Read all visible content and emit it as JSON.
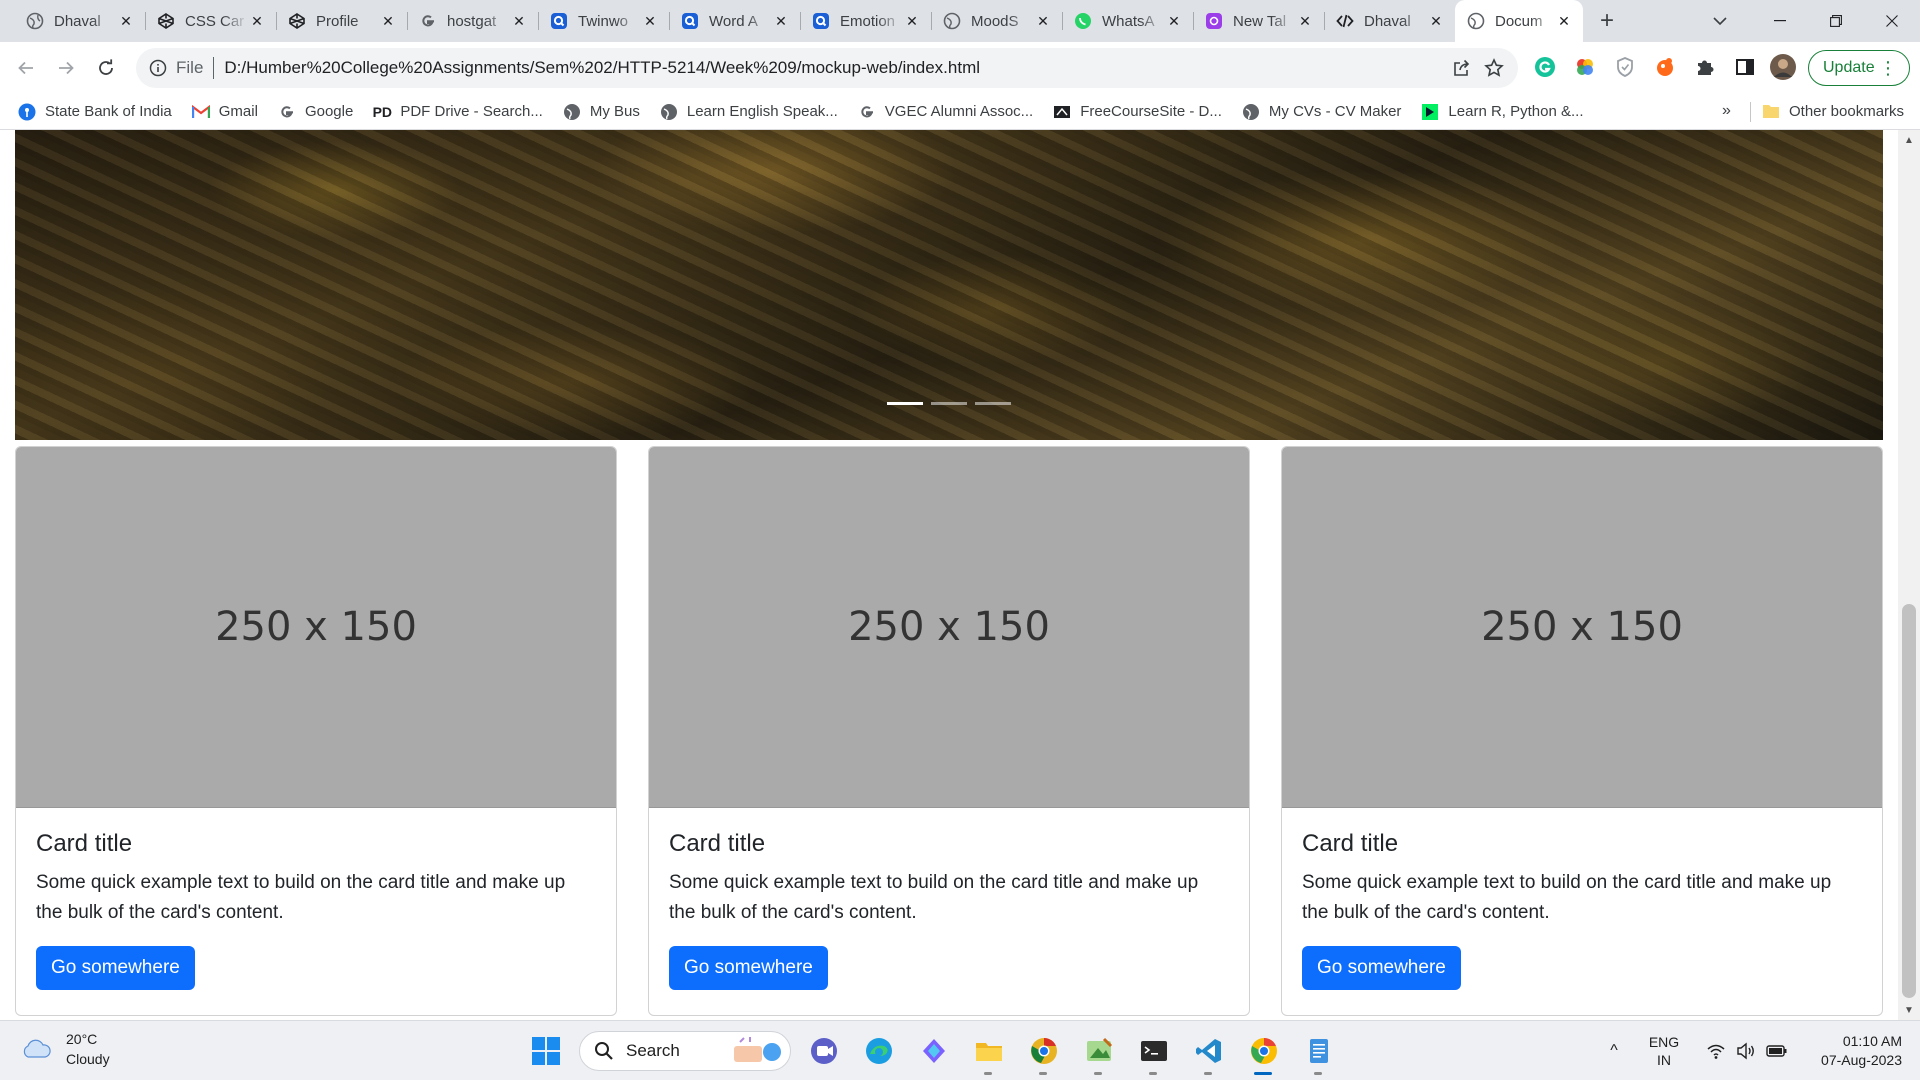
{
  "browser": {
    "tabs": [
      {
        "title": "Dhaval",
        "icon": "globe-icon"
      },
      {
        "title": "CSS Car",
        "icon": "codepen-icon"
      },
      {
        "title": "Profile",
        "icon": "codepen-icon"
      },
      {
        "title": "hostgat",
        "icon": "google-icon"
      },
      {
        "title": "Twinwo",
        "icon": "quillbot-icon"
      },
      {
        "title": "Word A",
        "icon": "quillbot-icon"
      },
      {
        "title": "Emotion",
        "icon": "quillbot-icon"
      },
      {
        "title": "MoodS",
        "icon": "globe-icon"
      },
      {
        "title": "WhatsA",
        "icon": "whatsapp-icon"
      },
      {
        "title": "New Tal",
        "icon": "newtab-icon"
      },
      {
        "title": "Dhaval",
        "icon": "code-icon"
      },
      {
        "title": "Docum",
        "icon": "globe-icon",
        "active": true
      }
    ],
    "address": {
      "scheme": "File",
      "url": "D:/Humber%20College%20Assignments/Sem%202/HTTP-5214/Week%209/mockup-web/index.html"
    },
    "update_label": "Update",
    "bookmarks": [
      {
        "label": "State Bank of India",
        "icon": "sbi-icon"
      },
      {
        "label": "Gmail",
        "icon": "gmail-icon"
      },
      {
        "label": "Google",
        "icon": "google-icon"
      },
      {
        "label": "PDF Drive - Search...",
        "icon": "pdfdrive-icon"
      },
      {
        "label": "My Bus",
        "icon": "globe-icon"
      },
      {
        "label": "Learn English Speak...",
        "icon": "globe-icon"
      },
      {
        "label": "VGEC Alumni Assoc...",
        "icon": "google-icon"
      },
      {
        "label": "FreeCourseSite - D...",
        "icon": "freecourse-icon"
      },
      {
        "label": "My CVs - CV Maker",
        "icon": "globe-icon"
      },
      {
        "label": "Learn R, Python &...",
        "icon": "datacamp-icon"
      }
    ],
    "bookmarks_overflow": "»",
    "other_bookmarks": "Other bookmarks"
  },
  "page": {
    "carousel": {
      "indicators": 3,
      "active_index": 0
    },
    "cards": [
      {
        "image_placeholder": "250 x 150",
        "title": "Card title",
        "text": "Some quick example text to build on the card title and make up the bulk of the card's content.",
        "button": "Go somewhere"
      },
      {
        "image_placeholder": "250 x 150",
        "title": "Card title",
        "text": "Some quick example text to build on the card title and make up the bulk of the card's content.",
        "button": "Go somewhere"
      },
      {
        "image_placeholder": "250 x 150",
        "title": "Card title",
        "text": "Some quick example text to build on the card title and make up the bulk of the card's content.",
        "button": "Go somewhere"
      }
    ]
  },
  "taskbar": {
    "weather": {
      "temp": "20°C",
      "condition": "Cloudy"
    },
    "search_label": "Search",
    "apps": [
      "widgets-icon",
      "teams-icon",
      "edge-icon",
      "copilot-icon",
      "file-explorer-icon",
      "chrome-canary-icon",
      "paint-icon",
      "terminal-icon",
      "vscode-icon",
      "chrome-icon",
      "notepad-icon"
    ],
    "tray": {
      "lang_line1": "ENG",
      "lang_line2": "IN",
      "time": "01:10 AM",
      "date": "07-Aug-2023"
    }
  },
  "colors": {
    "primary_button": "#0d6efd",
    "placeholder_gray": "#aaaaaa",
    "update_green": "#188038"
  }
}
